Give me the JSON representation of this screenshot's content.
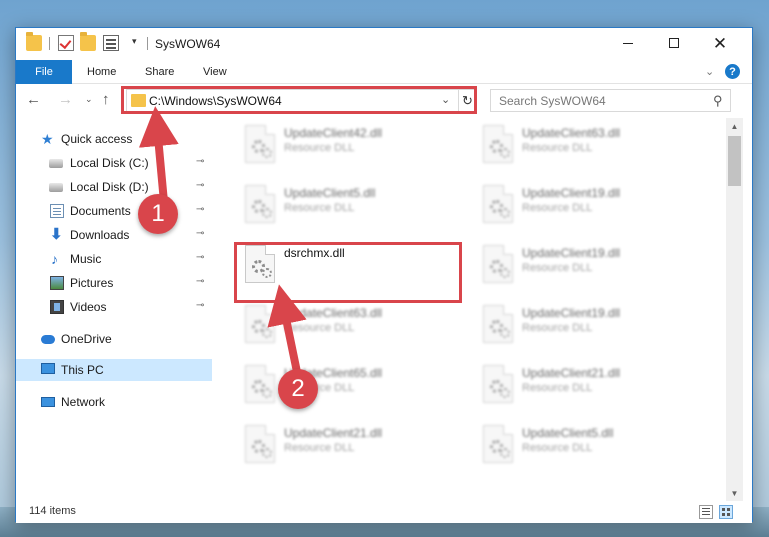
{
  "window": {
    "title": "SysWOW64",
    "controls": {
      "minimize": "minimize",
      "maximize": "maximize",
      "close": "✕"
    }
  },
  "quick_access_toolbar": {
    "dropdown": "▾"
  },
  "ribbon": {
    "file_tab": "File",
    "tabs": [
      "Home",
      "Share",
      "View"
    ],
    "collapse_chevron": "⌄",
    "help": "?"
  },
  "navigation": {
    "back": "←",
    "forward": "→",
    "recent_dropdown": "⌄",
    "up": "↑",
    "address": "C:\\Windows\\SysWOW64",
    "address_dropdown": "⌄",
    "refresh": "↻",
    "search_placeholder": "Search SysWOW64",
    "search_icon": "⚲"
  },
  "sidebar": {
    "items": [
      {
        "label": "Quick access",
        "icon": "star-icon",
        "pinned": false
      },
      {
        "label": "Local Disk (C:)",
        "icon": "drive-icon",
        "pinned": true
      },
      {
        "label": "Local Disk (D:)",
        "icon": "drive-icon",
        "pinned": true
      },
      {
        "label": "Documents",
        "icon": "documents-icon",
        "pinned": true
      },
      {
        "label": "Downloads",
        "icon": "downloads-icon",
        "pinned": true
      },
      {
        "label": "Music",
        "icon": "music-icon",
        "pinned": true
      },
      {
        "label": "Pictures",
        "icon": "pictures-icon",
        "pinned": true
      },
      {
        "label": "Videos",
        "icon": "videos-icon",
        "pinned": true
      },
      {
        "label": "OneDrive",
        "icon": "onedrive-icon",
        "pinned": false
      },
      {
        "label": "This PC",
        "icon": "this-pc-icon",
        "pinned": false,
        "selected": true
      },
      {
        "label": "Network",
        "icon": "network-icon",
        "pinned": false
      }
    ],
    "pin_glyph": "📌"
  },
  "files": {
    "column_1": [
      {
        "name": "UpdateClient42.dll",
        "type": "Resource DLL",
        "blurred": true
      },
      {
        "name": "UpdateClient5.dll",
        "type": "Resource DLL",
        "blurred": true
      },
      {
        "name": "dsrchmx.dll",
        "type": "",
        "blurred": false,
        "highlighted": true
      },
      {
        "name": "UpdateClient63.dll",
        "type": "Resource DLL",
        "blurred": true
      },
      {
        "name": "UpdateClient65.dll",
        "type": "Resource DLL",
        "blurred": true
      },
      {
        "name": "UpdateClient21.dll",
        "type": "Resource DLL",
        "blurred": true
      }
    ],
    "column_2": [
      {
        "name": "UpdateClient63.dll",
        "type": "Resource DLL",
        "blurred": true
      },
      {
        "name": "UpdateClient19.dll",
        "type": "Resource DLL",
        "blurred": true
      },
      {
        "name": "UpdateClient19.dll",
        "type": "Resource DLL",
        "blurred": true
      },
      {
        "name": "UpdateClient19.dll",
        "type": "Resource DLL",
        "blurred": true
      },
      {
        "name": "UpdateClient21.dll",
        "type": "Resource DLL",
        "blurred": true
      },
      {
        "name": "UpdateClient5.dll",
        "type": "Resource DLL",
        "blurred": true
      }
    ]
  },
  "scrollbar": {
    "up": "▲",
    "down": "▼"
  },
  "status": {
    "item_count": "114 items"
  },
  "annotations": {
    "step_1": "1",
    "step_2": "2"
  },
  "colors": {
    "accent": "#1979ca",
    "highlight_red": "#d9454b",
    "selected_nav": "#cce8ff"
  }
}
